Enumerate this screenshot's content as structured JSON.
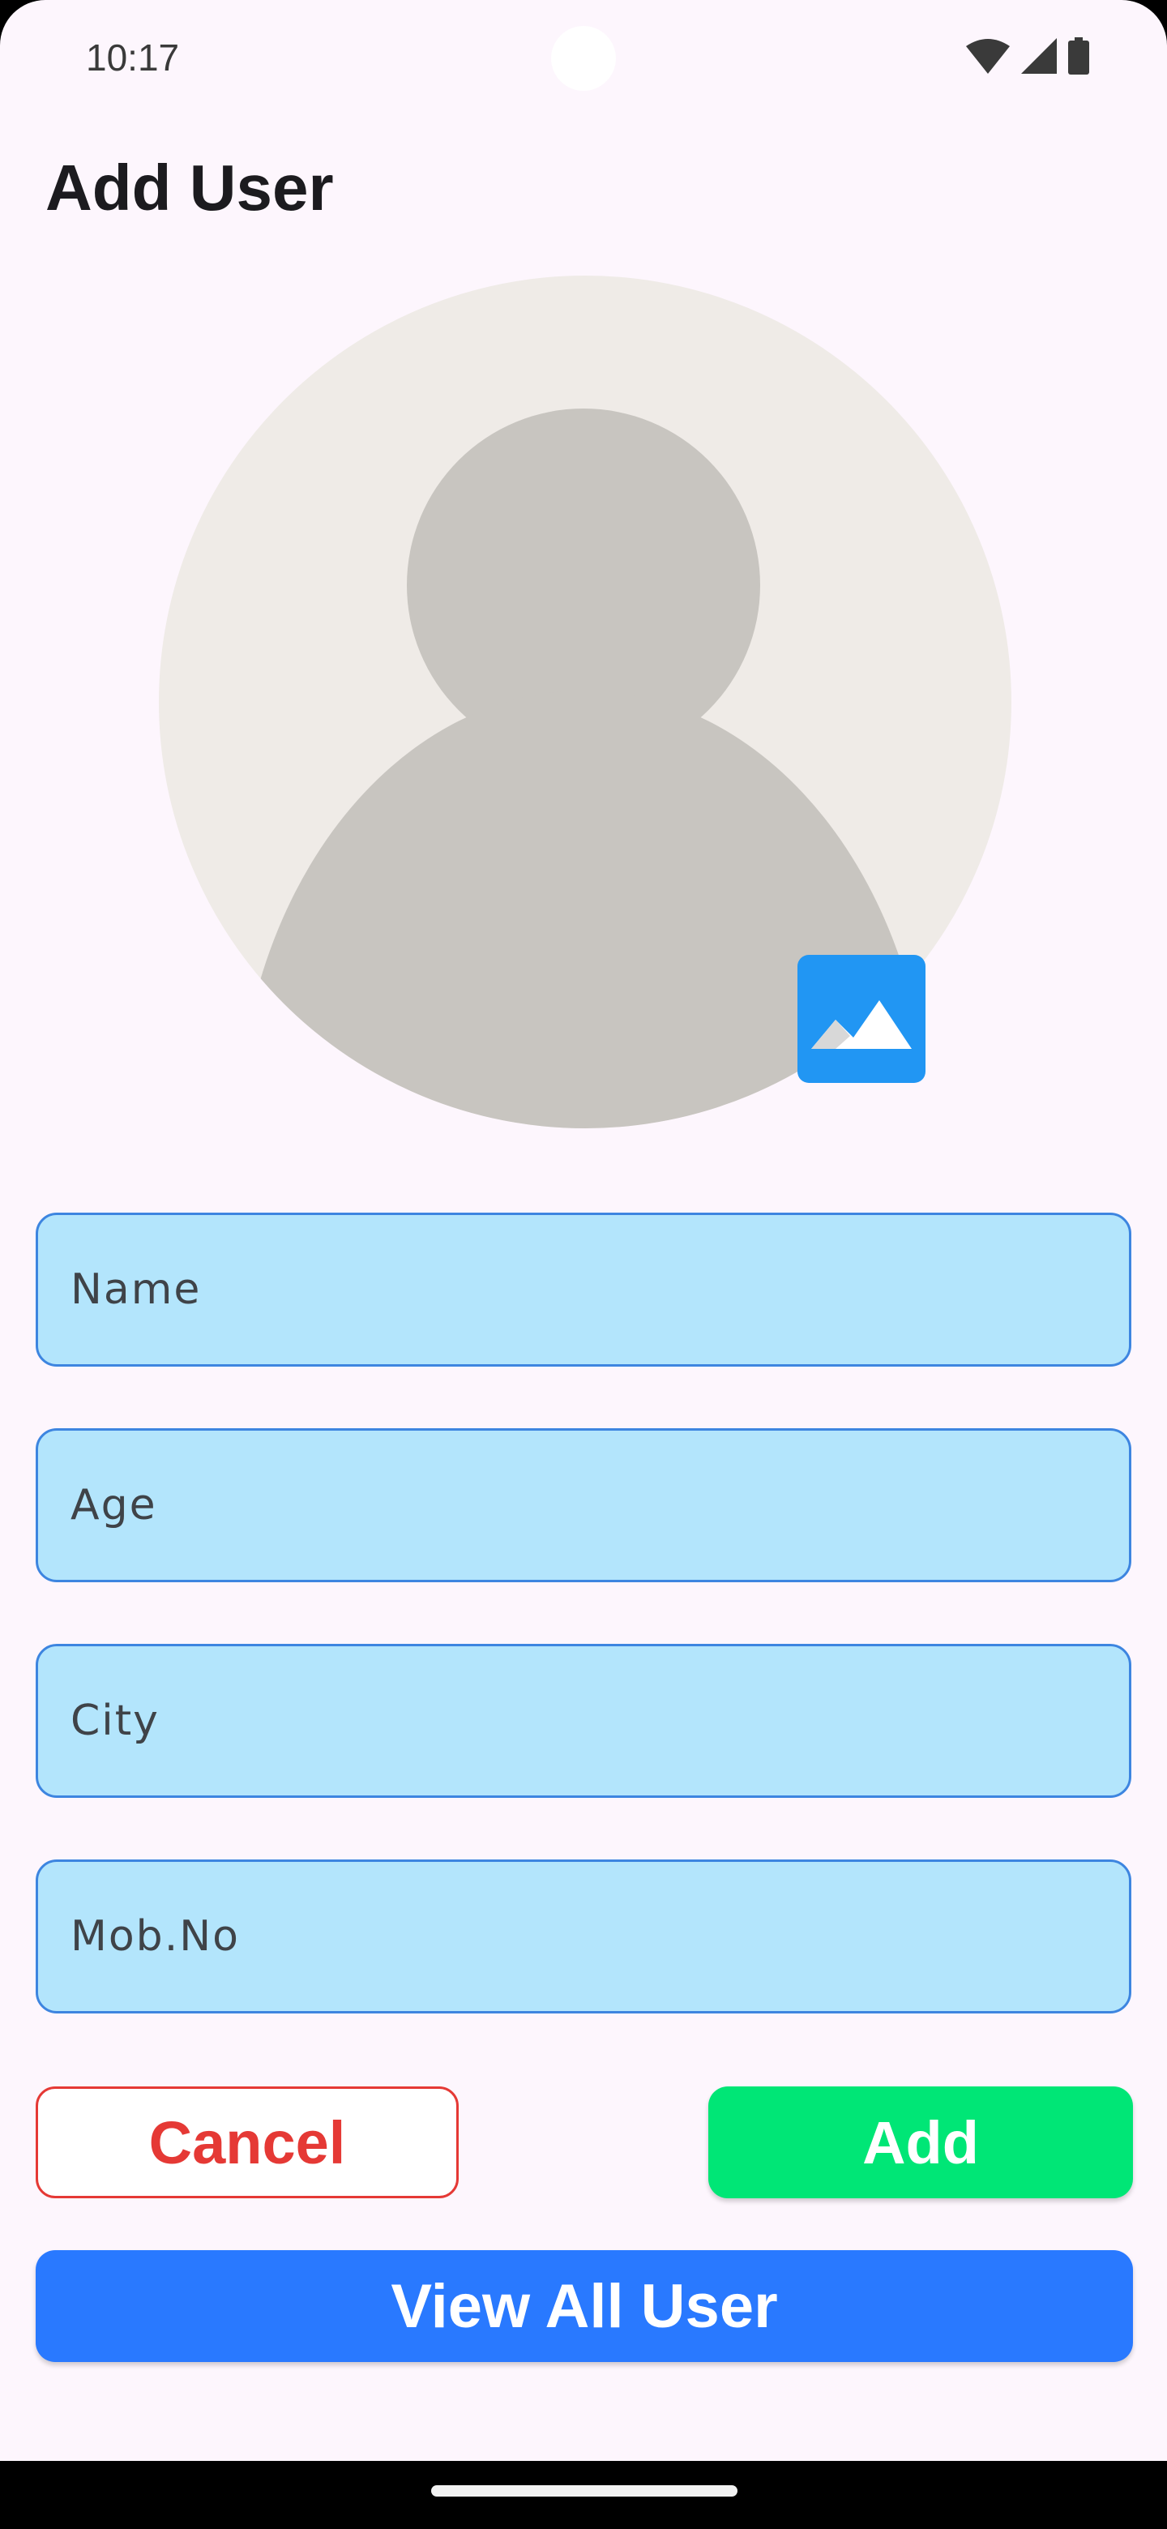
{
  "status_bar": {
    "time": "10:17",
    "icons": [
      "wifi-icon",
      "cellular-signal-icon",
      "battery-icon"
    ]
  },
  "header": {
    "title": "Add User"
  },
  "avatar": {
    "icon": "default-person-avatar-icon",
    "pick_image_icon": "image-picker-icon",
    "colors": {
      "circle": "#EFEBE7",
      "figure": "#C8C5C0",
      "picker": "#2196F3"
    }
  },
  "form": {
    "name": {
      "placeholder": "Name",
      "value": ""
    },
    "age": {
      "placeholder": "Age",
      "value": ""
    },
    "city": {
      "placeholder": "City",
      "value": ""
    },
    "mobile": {
      "placeholder": "Mob.No",
      "value": ""
    }
  },
  "actions": {
    "cancel_label": "Cancel",
    "add_label": "Add",
    "view_all_label": "View All User"
  },
  "colors": {
    "background": "#FDF6FD",
    "field_fill": "#B3E5FC",
    "field_border": "#3D85E0",
    "cancel": "#E53935",
    "add": "#00E676",
    "view_all": "#2979FF"
  }
}
